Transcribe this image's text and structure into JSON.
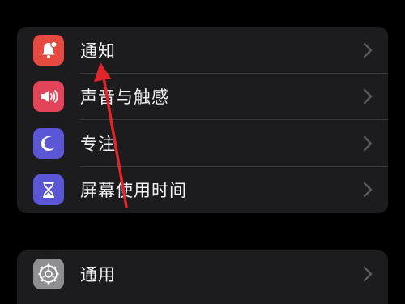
{
  "settings_group_1": [
    {
      "label": "通知",
      "icon": "bell-icon",
      "color": "#e5493f"
    },
    {
      "label": "声音与触感",
      "icon": "speaker-icon",
      "color": "#e3445a"
    },
    {
      "label": "专注",
      "icon": "moon-icon",
      "color": "#5b56d6"
    },
    {
      "label": "屏幕使用时间",
      "icon": "hourglass-icon",
      "color": "#5b56d6"
    }
  ],
  "settings_group_2": [
    {
      "label": "通用",
      "icon": "gear-icon",
      "color": "#8e8e93"
    }
  ],
  "annotation": {
    "color": "#e0252b"
  }
}
